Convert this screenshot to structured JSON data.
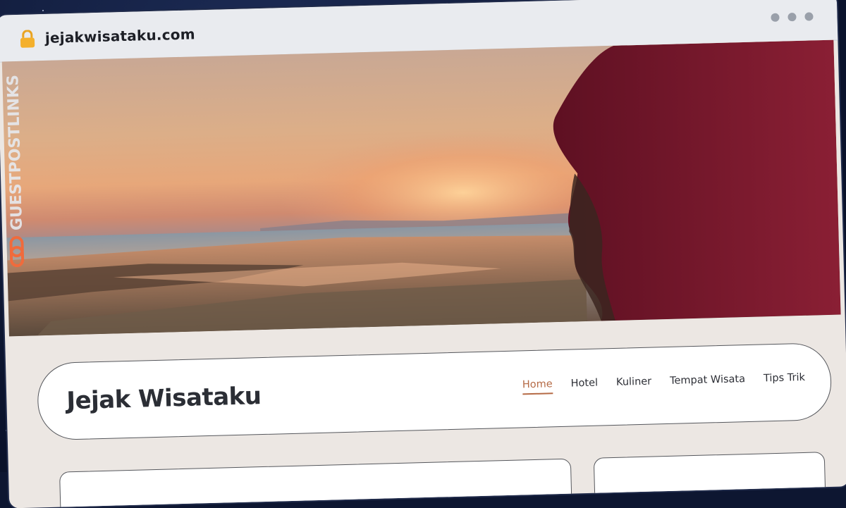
{
  "browser": {
    "url": "jejakwisataku.com",
    "lock_icon": "lock-icon",
    "window_controls": [
      "dot",
      "dot",
      "dot"
    ]
  },
  "hero": {
    "image": "sunset-beach-photo",
    "watermark": "GUESTPOSTLINKS"
  },
  "site": {
    "brand": "Jejak Wisataku",
    "accent_color": "#b56a45",
    "menu": [
      {
        "label": "Home",
        "active": true
      },
      {
        "label": "Hotel",
        "active": false
      },
      {
        "label": "Kuliner",
        "active": false
      },
      {
        "label": "Tempat Wisata",
        "active": false
      },
      {
        "label": "Tips Trik",
        "active": false
      }
    ]
  }
}
